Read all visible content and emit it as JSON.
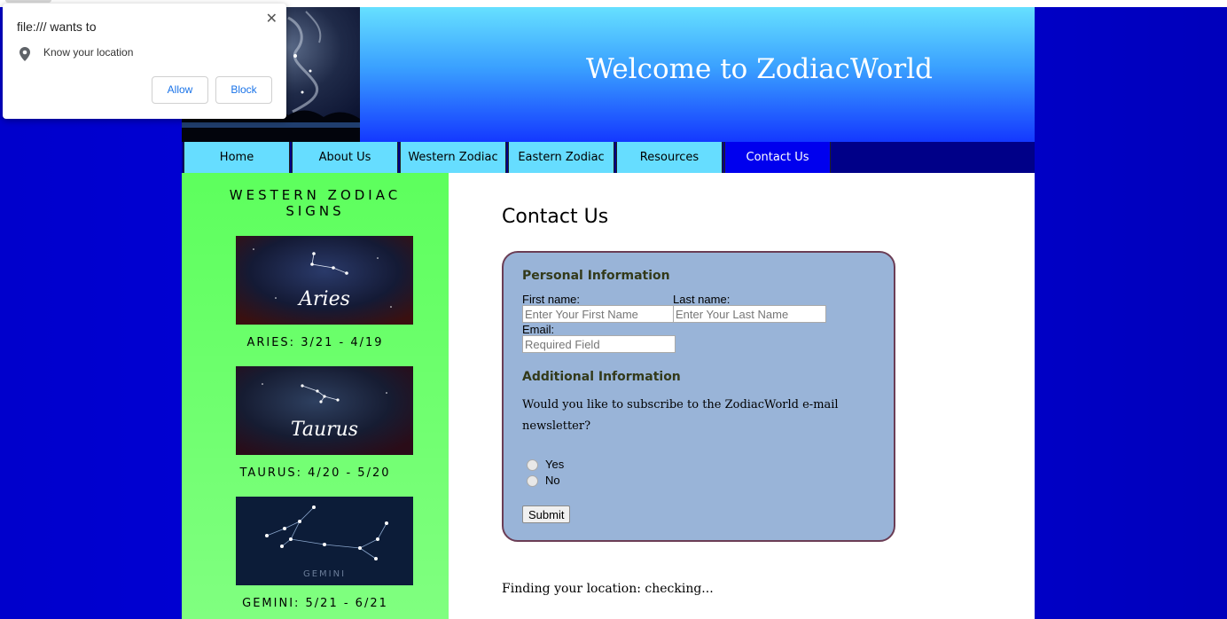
{
  "header": {
    "title": "Welcome to ZodiacWorld"
  },
  "nav": [
    {
      "label": "Home"
    },
    {
      "label": "About Us"
    },
    {
      "label": "Western Zodiac"
    },
    {
      "label": "Eastern Zodiac"
    },
    {
      "label": "Resources"
    },
    {
      "label": "Contact Us",
      "active": true
    }
  ],
  "sidebar": {
    "heading_line1": "WESTERN ZODIAC",
    "heading_line2": "SIGNS",
    "signs": [
      {
        "name": "Aries",
        "caption": "ARIES: 3/21 - 4/19"
      },
      {
        "name": "Taurus",
        "caption": "TAURUS: 4/20 - 5/20"
      },
      {
        "name": "GEMINI",
        "caption": "GEMINI: 5/21 - 6/21"
      }
    ]
  },
  "main": {
    "title": "Contact Us",
    "personal_heading": "Personal Information",
    "first_name_label": "First name:",
    "first_name_placeholder": "Enter Your First Name",
    "last_name_label": "Last name:",
    "last_name_placeholder": "Enter Your Last Name",
    "email_label": "Email:",
    "email_placeholder": "Required Field",
    "additional_heading": "Additional Information",
    "question": "Would you like to subscribe to the ZodiacWorld e-mail newsletter?",
    "option_yes": "Yes",
    "option_no": "No",
    "submit_label": "Submit",
    "location_status": "Finding your location: checking..."
  },
  "popup": {
    "title": "file:/// wants to",
    "permission": "Know your location",
    "allow_label": "Allow",
    "block_label": "Block",
    "close_glyph": "✕"
  },
  "colors": {
    "background": "#0000cc",
    "nav_item": "#66ddff",
    "nav_active": "#0000ee",
    "sidebar": "#66ff66",
    "form_box": "#99b4d8",
    "form_border": "#6b3d55"
  }
}
